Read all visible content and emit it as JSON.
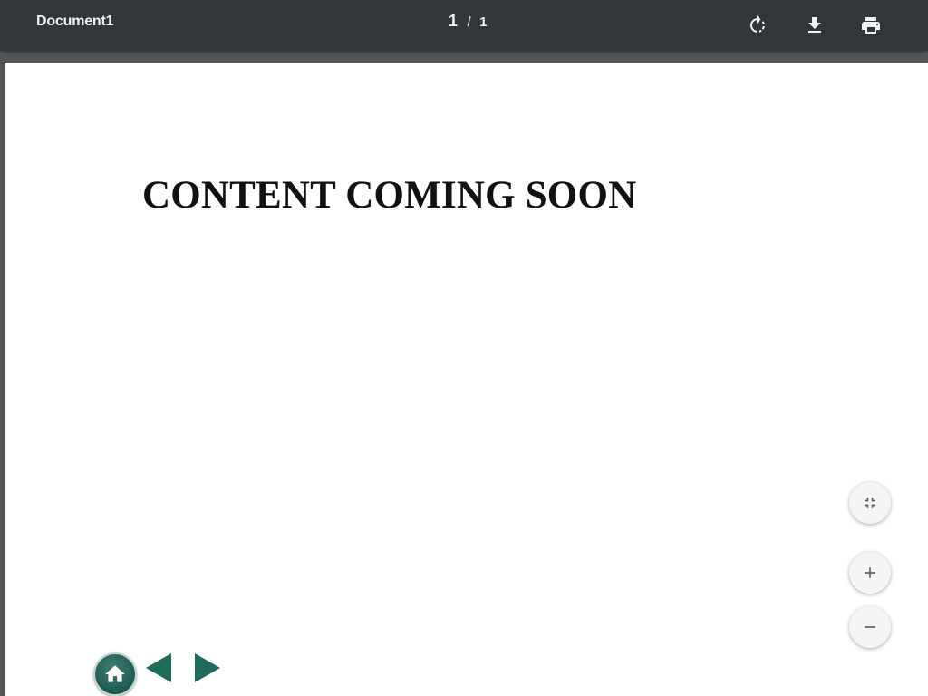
{
  "toolbar": {
    "title": "Document1",
    "page_current": "1",
    "page_separator": "/",
    "page_total": "1",
    "icons": {
      "rotate": "rotate-icon",
      "download": "download-icon",
      "print": "print-icon"
    }
  },
  "page": {
    "heading": "CONTENT COMING SOON"
  },
  "navigation": {
    "icons": {
      "home": "home-icon",
      "previous": "arrow-left-icon",
      "next": "arrow-right-icon"
    },
    "accent_color": "#1e6b5c"
  },
  "zoom_controls": {
    "icons": {
      "fit": "fit-to-page-icon",
      "zoom_in": "plus-icon",
      "zoom_out": "minus-icon"
    }
  },
  "colors": {
    "toolbar_bg": "#323639",
    "viewer_bg": "#525659",
    "page_bg": "#ffffff"
  }
}
